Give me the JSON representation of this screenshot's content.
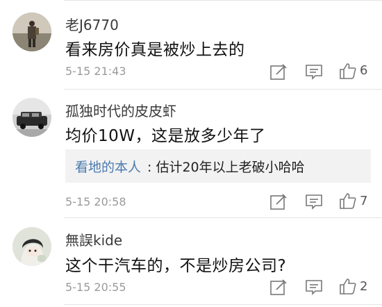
{
  "comments": [
    {
      "username": "老J6770",
      "content": "看来房价真是被炒上去的",
      "time": "5-15 21:43",
      "likes": "6",
      "avatar_icon": "avatar-hiker-photo"
    },
    {
      "username": "孤独时代的皮皮虾",
      "content": "均价10W，这是放多少年了",
      "time": "5-15 20:58",
      "likes": "7",
      "avatar_icon": "avatar-car-photo",
      "reply": {
        "user": "看地的本人",
        "text": "估计20年以上老破小哈哈"
      }
    },
    {
      "username": "無誤kide",
      "content": "这个干汽车的，不是炒房公司?",
      "time": "5-15 20:55",
      "likes": "2",
      "avatar_icon": "avatar-anime-photo"
    }
  ],
  "reply_separator": ": ",
  "colors": {
    "reply_user": "#4a7bb0",
    "icon_gray": "#777777",
    "divider": "#e4e4e4"
  }
}
